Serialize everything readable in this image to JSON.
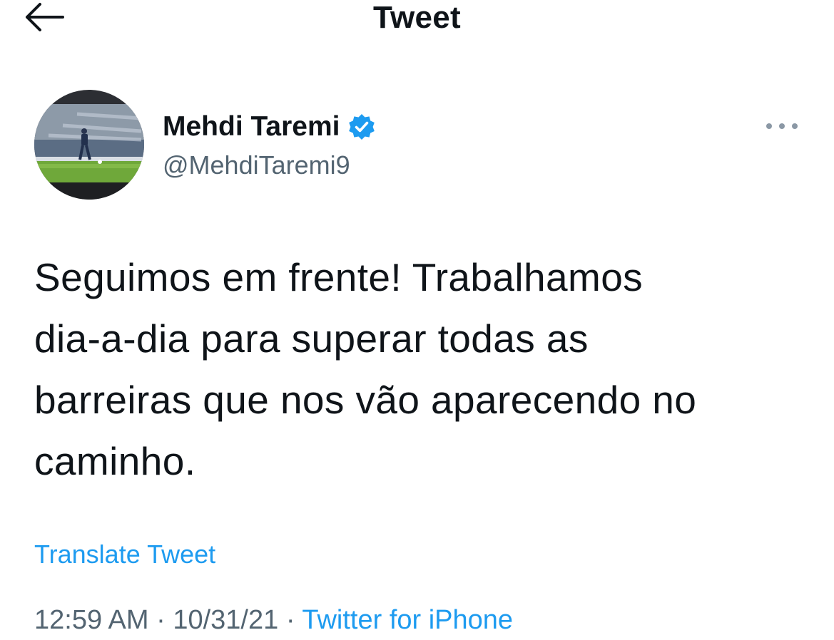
{
  "header": {
    "title": "Tweet",
    "back_icon": "arrow-left-icon"
  },
  "author": {
    "display_name": "Mehdi Taremi",
    "handle": "@MehdiTaremi9",
    "verified": true,
    "verified_icon": "verified-badge-icon"
  },
  "more_icon": "more-horizontal-icon",
  "tweet": {
    "text": "Seguimos em frente! Trabalhamos\ndia-a-dia para superar todas as\nbarreiras que nos vão aparecendo no\ncaminho.",
    "translate_label": "Translate Tweet",
    "time": "12:59 AM",
    "date": "10/31/21",
    "separator": "·",
    "source": "Twitter for iPhone"
  },
  "colors": {
    "accent": "#1d9bf0",
    "text": "#0f1419",
    "secondary": "#536471"
  }
}
